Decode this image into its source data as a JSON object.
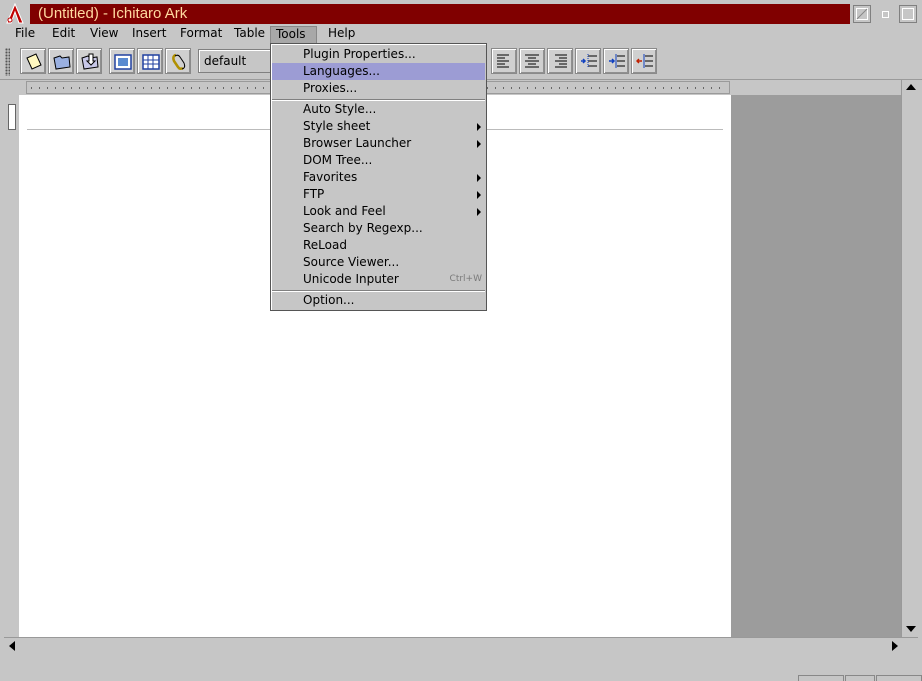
{
  "window": {
    "title": "(Untitled) - Ichitaro Ark",
    "title_color": "#800000"
  },
  "menubar": {
    "items": [
      {
        "label": "File"
      },
      {
        "label": "Edit"
      },
      {
        "label": "View"
      },
      {
        "label": "Insert"
      },
      {
        "label": "Format"
      },
      {
        "label": "Table"
      },
      {
        "label": "Tools"
      },
      {
        "label": "Help"
      }
    ]
  },
  "toolbar": {
    "style_value": "default"
  },
  "tools_menu": {
    "items": [
      {
        "label": "Plugin Properties..."
      },
      {
        "label": "Languages..."
      },
      {
        "label": "Proxies..."
      },
      {
        "label": "Auto Style..."
      },
      {
        "label": "Style sheet"
      },
      {
        "label": "Browser Launcher"
      },
      {
        "label": "DOM Tree..."
      },
      {
        "label": "Favorites"
      },
      {
        "label": "FTP"
      },
      {
        "label": "Look and Feel"
      },
      {
        "label": "Search by Regexp..."
      },
      {
        "label": "ReLoad"
      },
      {
        "label": "Source Viewer..."
      },
      {
        "label": "Unicode Inputer",
        "shortcut": "Ctrl+W"
      },
      {
        "label": "Option..."
      }
    ],
    "highlight_color": "#9c9cd4"
  }
}
